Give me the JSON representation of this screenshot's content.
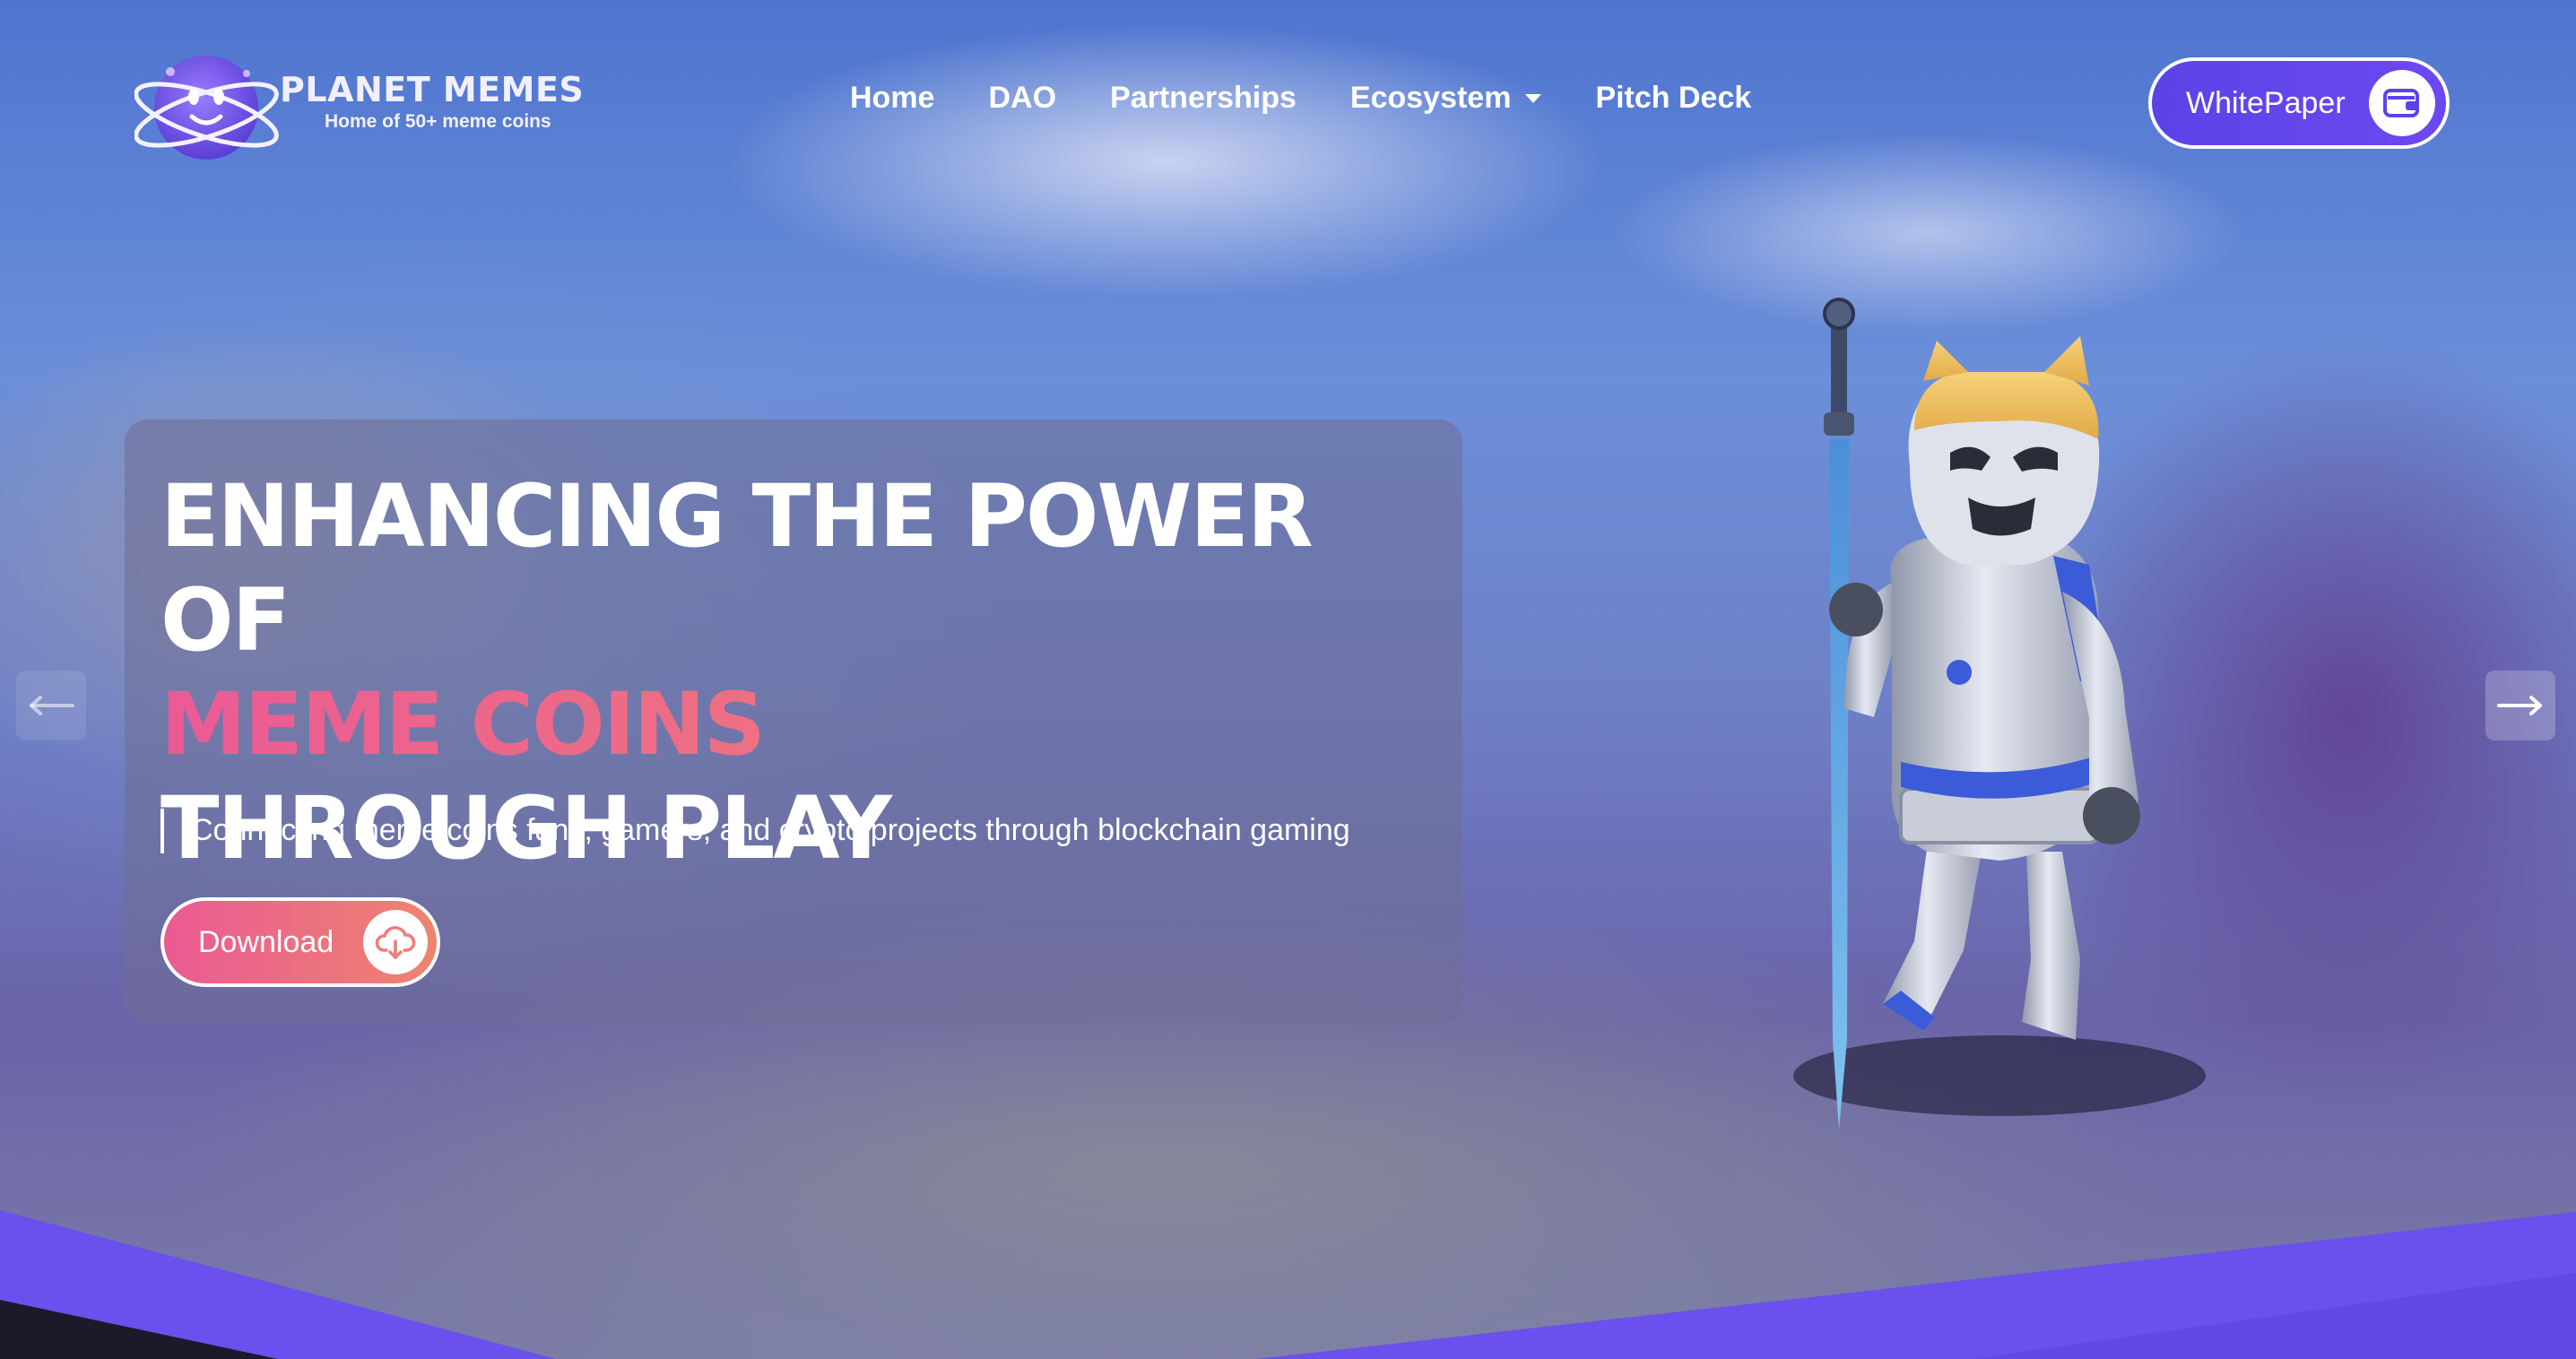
{
  "brand": {
    "name": "PLANET MEMES",
    "tagline": "Home of 50+ meme coins"
  },
  "nav": {
    "items": [
      {
        "label": "Home"
      },
      {
        "label": "DAO"
      },
      {
        "label": "Partnerships"
      },
      {
        "label": "Ecosystem",
        "has_dropdown": true
      },
      {
        "label": "Pitch Deck"
      }
    ]
  },
  "whitepaper_button": {
    "label": "WhitePaper",
    "icon": "wallet-icon"
  },
  "hero": {
    "headline_line1": "ENHANCING THE POWER OF",
    "headline_line2": "MEME COINS",
    "headline_line3": "THROUGH PLAY",
    "subtitle": "Connecting meme coins fans, gamers, and crypto projects through blockchain gaming",
    "download_button": {
      "label": "Download",
      "icon": "cloud-download-icon"
    }
  },
  "carousel": {
    "prev_icon": "arrow-left-icon",
    "next_icon": "arrow-right-icon"
  },
  "colors": {
    "accent_purple": "#5b43e8",
    "accent_pink": "#ea5a93",
    "accent_coral": "#ee8470",
    "footer_dark": "#1c1a2a"
  }
}
